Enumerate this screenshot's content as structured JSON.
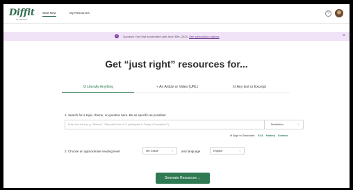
{
  "nav": {
    "logo": "Diffit",
    "logo_sub": "for Teachers",
    "tabs": [
      {
        "label": "Start New"
      },
      {
        "label": "My Resources"
      }
    ],
    "help_icon": "?"
  },
  "banner": {
    "text": "Success! Your trial is extended until June 30th, 2024.",
    "link": "See subscription options",
    "close": "×",
    "icon": "i",
    "color": "#f1e3f7"
  },
  "headline": "Get “just right” resources for...",
  "tabs": [
    {
      "icon": "search-icon",
      "label": "Q Literally Anything"
    },
    {
      "icon": "link-icon",
      "label": "⑂ An Article or Video (URL)"
    },
    {
      "icon": "document-icon",
      "label": "☷ Any text or Excerpt"
    }
  ],
  "step1": {
    "label": "1. Search for a topic, theme, or question here. Be as specific as possible!",
    "placeholder": "Enter text here (e.g. \"Mitosis\", \"Why didn't the U.S. participate in Treaty of Versailles?\")",
    "type_value": "Nonfiction",
    "align_label": "⊕ Align to Standards:",
    "standards": [
      "ELA",
      "History",
      "Science"
    ]
  },
  "step2": {
    "label": "2. Choose an approximate reading level",
    "level_value": "5th Grade",
    "lang_label": "and language",
    "lang_value": "English"
  },
  "generate_label": "Generate Resources →",
  "colors": {
    "accent": "#2f7a53",
    "banner": "#f1e3f7"
  }
}
